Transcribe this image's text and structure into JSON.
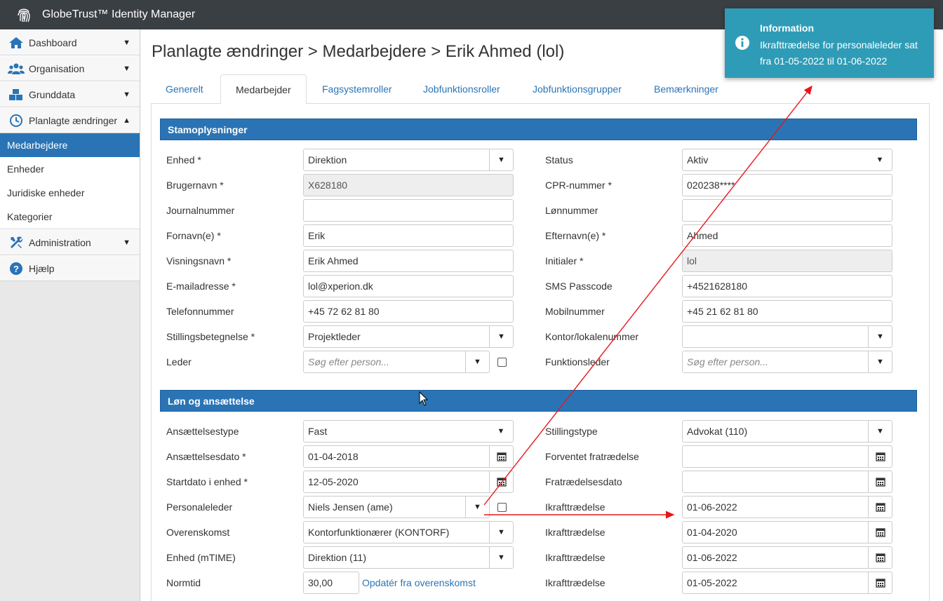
{
  "app": {
    "title": "GlobeTrust™ Identity Manager"
  },
  "sidebar": {
    "items": [
      {
        "label": "Dashboard"
      },
      {
        "label": "Organisation"
      },
      {
        "label": "Grunddata"
      },
      {
        "label": "Planlagte ændringer"
      }
    ],
    "subitems": [
      {
        "label": "Medarbejdere"
      },
      {
        "label": "Enheder"
      },
      {
        "label": "Juridiske enheder"
      },
      {
        "label": "Kategorier"
      }
    ],
    "bottom": [
      {
        "label": "Administration"
      },
      {
        "label": "Hjælp"
      }
    ]
  },
  "page": {
    "title": "Planlagte ændringer > Medarbejdere > Erik Ahmed (lol)"
  },
  "tabs": [
    {
      "label": "Generelt"
    },
    {
      "label": "Medarbejder"
    },
    {
      "label": "Fagsystemroller"
    },
    {
      "label": "Jobfunktionsroller"
    },
    {
      "label": "Jobfunktionsgrupper"
    },
    {
      "label": "Bemærkninger"
    }
  ],
  "stam": {
    "heading": "Stamoplysninger",
    "enhed": {
      "label": "Enhed *",
      "value": "Direktion"
    },
    "brugernavn": {
      "label": "Brugernavn *",
      "value": "X628180"
    },
    "journalnummer": {
      "label": "Journalnummer",
      "value": ""
    },
    "fornavn": {
      "label": "Fornavn(e) *",
      "value": "Erik"
    },
    "visningsnavn": {
      "label": "Visningsnavn *",
      "value": "Erik Ahmed"
    },
    "email": {
      "label": "E-mailadresse *",
      "value": "lol@xperion.dk"
    },
    "telefon": {
      "label": "Telefonnummer",
      "value": "+45 72 62 81 80"
    },
    "stilling": {
      "label": "Stillingsbetegnelse *",
      "value": "Projektleder"
    },
    "leder": {
      "label": "Leder",
      "placeholder": "Søg efter person..."
    },
    "status": {
      "label": "Status",
      "value": "Aktiv"
    },
    "cpr": {
      "label": "CPR-nummer *",
      "value": "020238****"
    },
    "lonnummer": {
      "label": "Lønnummer",
      "value": ""
    },
    "efternavn": {
      "label": "Efternavn(e) *",
      "value": "Ahmed"
    },
    "initialer": {
      "label": "Initialer *",
      "value": "lol"
    },
    "sms": {
      "label": "SMS Passcode",
      "value": "+4521628180"
    },
    "mobil": {
      "label": "Mobilnummer",
      "value": "+45 21 62 81 80"
    },
    "kontor": {
      "label": "Kontor/lokalenummer",
      "value": ""
    },
    "funktionsleder": {
      "label": "Funktionsleder",
      "placeholder": "Søg efter person..."
    }
  },
  "lon": {
    "heading": "Løn og ansættelse",
    "ansaettelsestype": {
      "label": "Ansættelsestype",
      "value": "Fast"
    },
    "ansaettelsesdato": {
      "label": "Ansættelsesdato *",
      "value": "01-04-2018"
    },
    "startdato": {
      "label": "Startdato i enhed *",
      "value": "12-05-2020"
    },
    "personaleleder": {
      "label": "Personaleleder",
      "value": "Niels Jensen (ame)"
    },
    "overenskomst": {
      "label": "Overenskomst",
      "value": "Kontorfunktionærer (KONTORF)"
    },
    "enhed_mtime": {
      "label": "Enhed (mTIME)",
      "value": "Direktion (11)"
    },
    "normtid": {
      "label": "Normtid",
      "value": "30,00",
      "link": "Opdatér fra overenskomst"
    },
    "stillingstype": {
      "label": "Stillingstype",
      "value": "Advokat (110)"
    },
    "forventet": {
      "label": "Forventet fratrædelse",
      "value": ""
    },
    "fratraedelse": {
      "label": "Fratrædelsesdato",
      "value": ""
    },
    "ikraft1": {
      "label": "Ikrafttrædelse",
      "value": "01-06-2022"
    },
    "ikraft2": {
      "label": "Ikrafttrædelse",
      "value": "01-04-2020"
    },
    "ikraft3": {
      "label": "Ikrafttrædelse",
      "value": "01-06-2022"
    },
    "ikraft4": {
      "label": "Ikrafttrædelse",
      "value": "01-05-2022"
    }
  },
  "toast": {
    "title": "Information",
    "message": "Ikrafttrædelse for personaleleder sat fra 01-05-2022 til 01-06-2022"
  },
  "colors": {
    "primary": "#2a74b5",
    "topbar": "#3a3f44",
    "toast": "#2f9cb7",
    "annotation": "#e8161c"
  }
}
